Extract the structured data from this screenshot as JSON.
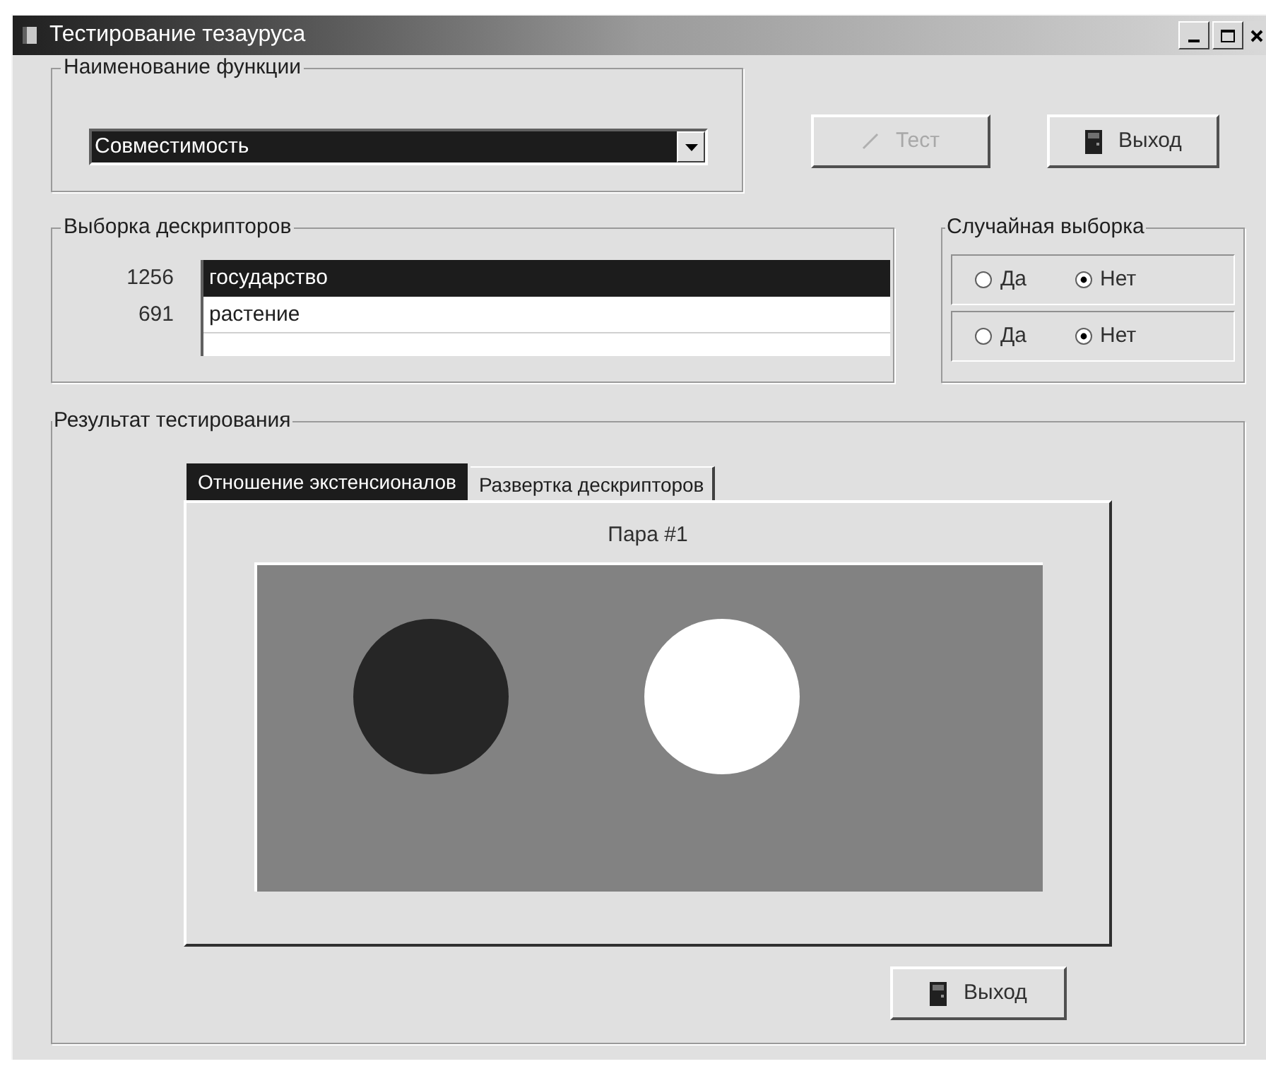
{
  "window": {
    "title": "Тестирование тезауруса"
  },
  "function_group": {
    "label": "Наименование функции",
    "combo_value": "Совместимость"
  },
  "buttons": [
    {
      "label": "Тест",
      "disabled": true
    },
    {
      "label": "Выход",
      "disabled": false
    }
  ],
  "descriptors": {
    "label": "Выборка дескрипторов",
    "rows": [
      {
        "number": "1256",
        "text": "государство",
        "selected": true
      },
      {
        "number": "691",
        "text": "растение",
        "selected": false
      }
    ]
  },
  "random_sample": {
    "label": "Случайная выборка",
    "rows": [
      {
        "options": [
          {
            "label": "Да",
            "selected": false
          },
          {
            "label": "Нет",
            "selected": true
          }
        ]
      },
      {
        "options": [
          {
            "label": "Да",
            "selected": false
          },
          {
            "label": "Нет",
            "selected": true
          }
        ]
      }
    ]
  },
  "result": {
    "label": "Результат тестирования",
    "tabs": [
      {
        "label": "Отношение экстенсионалов",
        "selected": true
      },
      {
        "label": "Развертка дескрипторов",
        "selected": false
      }
    ],
    "pair_title": "Пара #1",
    "circles": [
      {
        "color": "#262626"
      },
      {
        "color": "#ffffff"
      }
    ],
    "exit_button": {
      "label": "Выход"
    }
  }
}
